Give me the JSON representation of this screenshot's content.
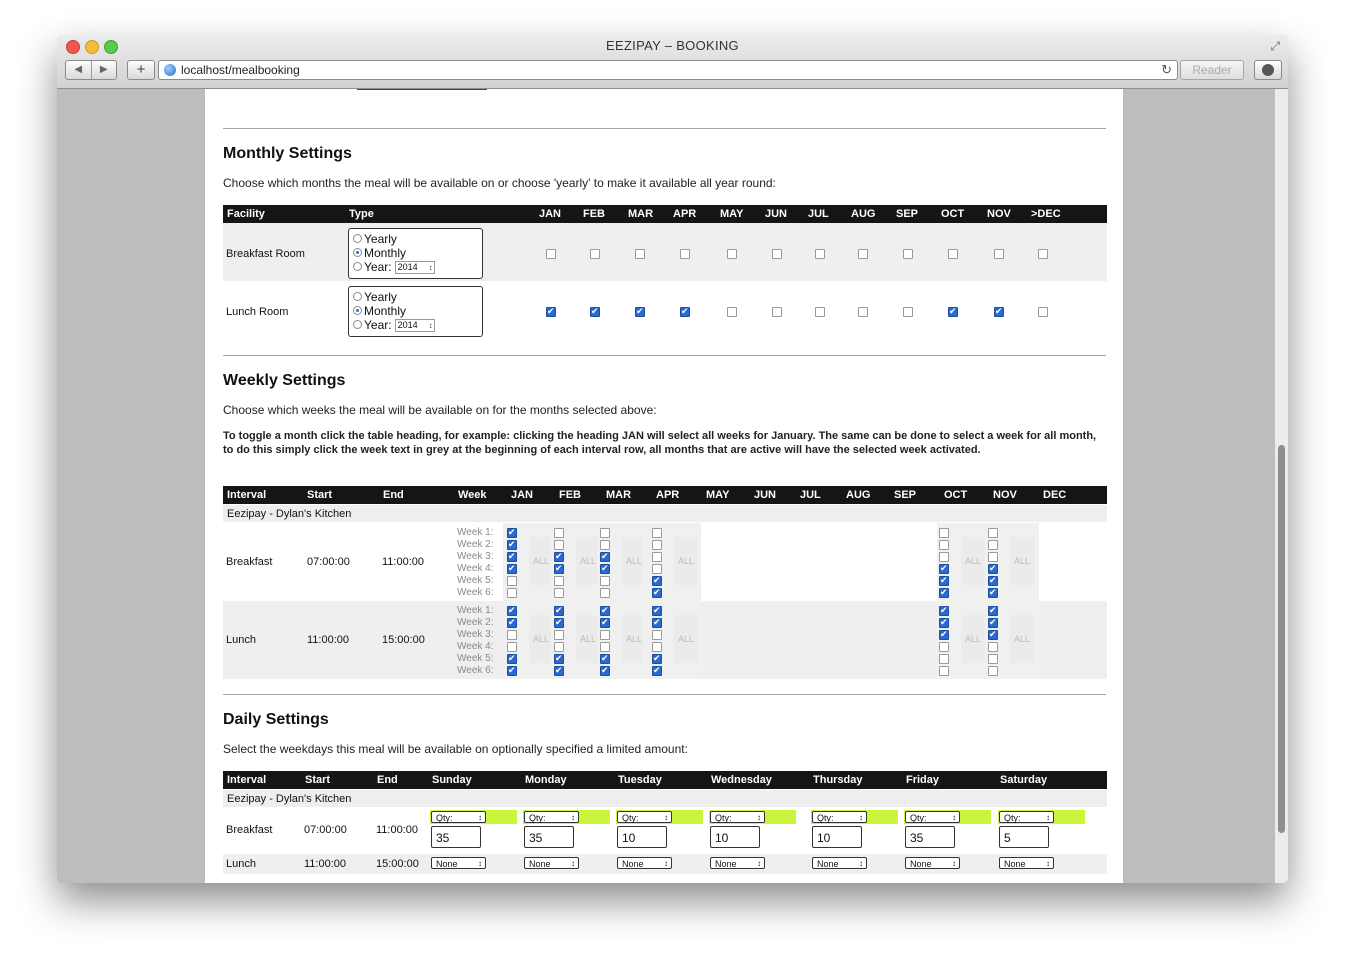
{
  "browser": {
    "title": "EEZIPAY – BOOKING",
    "url": "localhost/mealbooking",
    "reader_label": "Reader"
  },
  "monthly": {
    "title": "Monthly Settings",
    "description": "Choose which months the meal will be available on or choose 'yearly' to make it available all year round:",
    "headers": {
      "facility": "Facility",
      "type": "Type"
    },
    "months": [
      "JAN",
      "FEB",
      "MAR",
      "APR",
      "MAY",
      "JUN",
      "JUL",
      "AUG",
      "SEP",
      "OCT",
      "NOV",
      ">DEC"
    ],
    "type_options": [
      "Yearly",
      "Monthly",
      "Year:"
    ],
    "rows": [
      {
        "facility": "Breakfast Room",
        "selected": "Monthly",
        "year": "2014",
        "checks": [
          false,
          false,
          false,
          false,
          false,
          false,
          false,
          false,
          false,
          false,
          false,
          false
        ]
      },
      {
        "facility": "Lunch Room",
        "selected": "Monthly",
        "year": "2014",
        "checks": [
          true,
          true,
          true,
          true,
          false,
          false,
          false,
          false,
          false,
          true,
          true,
          false
        ]
      }
    ]
  },
  "weekly": {
    "title": "Weekly Settings",
    "description": "Choose which weeks the meal will be available on for the months selected above:",
    "note": "To toggle a month click the table heading, for example: clicking the heading JAN will select all weeks for January. The same can be done to select a week for all month, to do this simply click the week text in grey at the beginning of each interval row, all months that are active will have the selected week activated.",
    "headers": {
      "interval": "Interval",
      "start": "Start",
      "end": "End",
      "week": "Week"
    },
    "months": [
      "JAN",
      "FEB",
      "MAR",
      "APR",
      "MAY",
      "JUN",
      "JUL",
      "AUG",
      "SEP",
      "OCT",
      "NOV",
      "DEC"
    ],
    "group": "Eezipay - Dylan's Kitchen",
    "week_labels": [
      "Week 1:",
      "Week 2:",
      "Week 3:",
      "Week 4:",
      "Week 5:",
      "Week 6:"
    ],
    "all_label": "ALL",
    "rows": [
      {
        "interval": "Breakfast",
        "start": "07:00:00",
        "end": "11:00:00",
        "months": {
          "JAN": [
            true,
            true,
            true,
            true,
            false,
            false
          ],
          "FEB": [
            false,
            false,
            true,
            true,
            false,
            false
          ],
          "MAR": [
            false,
            false,
            true,
            true,
            false,
            false
          ],
          "APR": [
            false,
            false,
            false,
            false,
            true,
            true
          ],
          "OCT": [
            false,
            false,
            false,
            true,
            true,
            true
          ],
          "NOV": [
            false,
            false,
            false,
            true,
            true,
            true
          ]
        }
      },
      {
        "interval": "Lunch",
        "start": "11:00:00",
        "end": "15:00:00",
        "months": {
          "JAN": [
            true,
            true,
            false,
            false,
            true,
            true
          ],
          "FEB": [
            true,
            true,
            false,
            false,
            true,
            true
          ],
          "MAR": [
            true,
            true,
            false,
            false,
            true,
            true
          ],
          "APR": [
            true,
            true,
            false,
            false,
            true,
            true
          ],
          "OCT": [
            true,
            true,
            true,
            false,
            false,
            false
          ],
          "NOV": [
            true,
            true,
            true,
            false,
            false,
            false
          ]
        }
      }
    ]
  },
  "daily": {
    "title": "Daily Settings",
    "description": "Select the weekdays this meal will be available on optionally specified a limited amount:",
    "headers": {
      "interval": "Interval",
      "start": "Start",
      "end": "End"
    },
    "days": [
      "Sunday",
      "Monday",
      "Tuesday",
      "Wednesday",
      "Thursday",
      "Friday",
      "Saturday"
    ],
    "group": "Eezipay - Dylan's Kitchen",
    "rows": [
      {
        "interval": "Breakfast",
        "start": "07:00:00",
        "end": "11:00:00",
        "mode": "Qty:",
        "values": [
          "35",
          "35",
          "10",
          "10",
          "10",
          "35",
          "5"
        ]
      },
      {
        "interval": "Lunch",
        "start": "11:00:00",
        "end": "15:00:00",
        "mode": "None",
        "values": []
      }
    ]
  },
  "colors": {
    "qty_highlight": "#c9f53a",
    "checkbox_on": "#2a6ad0",
    "header_bg": "#151515"
  }
}
